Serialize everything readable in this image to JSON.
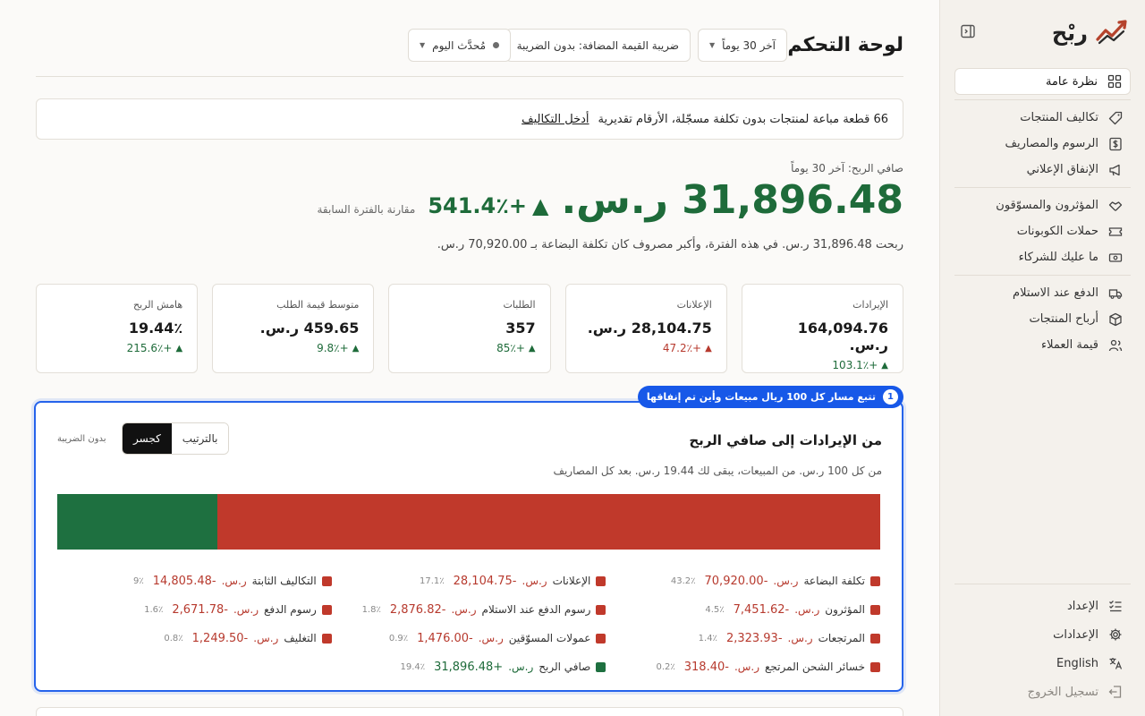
{
  "brand": {
    "name": "ربْح"
  },
  "sidebar": {
    "groups": [
      [
        {
          "label": "نظرة عامة",
          "icon": "grid-icon",
          "active": true
        }
      ],
      [
        {
          "label": "تكاليف المنتجات",
          "icon": "tag-icon"
        },
        {
          "label": "الرسوم والمصاريف",
          "icon": "dollar-icon"
        },
        {
          "label": "الإنفاق الإعلاني",
          "icon": "megaphone-icon"
        }
      ],
      [
        {
          "label": "المؤثرون والمسوّقون",
          "icon": "handshake-icon"
        },
        {
          "label": "حملات الكوبونات",
          "icon": "ticket-icon"
        },
        {
          "label": "ما عليك للشركاء",
          "icon": "cash-icon"
        }
      ],
      [
        {
          "label": "الدفع عند الاستلام",
          "icon": "truck-icon"
        },
        {
          "label": "أرباح المنتجات",
          "icon": "box-icon"
        },
        {
          "label": "قيمة العملاء",
          "icon": "users-icon"
        }
      ]
    ],
    "bottom": [
      {
        "label": "الإعداد",
        "icon": "checklist-icon"
      },
      {
        "label": "الإعدادات",
        "icon": "gear-icon"
      },
      {
        "label": "English",
        "icon": "translate-icon"
      },
      {
        "label": "تسجيل الخروج",
        "icon": "logout-icon",
        "muted": true
      }
    ]
  },
  "header": {
    "title": "لوحة التحكم",
    "period": "آخر 30 يوماً",
    "vat": "ضريبة القيمة المضافة: بدون الضريبة",
    "updated": "مُحدَّث اليوم"
  },
  "notice": {
    "text": "66 قطعة مباعة لمنتجات بدون تكلفة مسجّلة، الأرقام تقديرية",
    "link": "أدخل التكاليف"
  },
  "profit": {
    "label": "صافي الربح: آخر 30 يوماً",
    "value": "31,896.48 ر.س.",
    "change": "+541.4٪",
    "compare": "مقارنة بالفترة السابقة",
    "summary": "ربحت 31,896.48 ر.س. في هذه الفترة، وأكبر مصروف كان تكلفة البضاعة بـ 70,920.00 ر.س."
  },
  "kpis": [
    {
      "label": "الإيرادات",
      "value": "164,094.76 ر.س.",
      "delta": "+103.1٪",
      "tone": "green"
    },
    {
      "label": "الإعلانات",
      "value": "28,104.75 ر.س.",
      "delta": "+47.2٪",
      "tone": "red"
    },
    {
      "label": "الطلبات",
      "value": "357",
      "delta": "+85٪",
      "tone": "green"
    },
    {
      "label": "متوسط قيمة الطلب",
      "value": "459.65 ر.س.",
      "delta": "+9.8٪",
      "tone": "green"
    },
    {
      "label": "هامش الربح",
      "value": "19.44٪",
      "delta": "+215.6٪",
      "tone": "green"
    }
  ],
  "step": {
    "number": "1",
    "text": "تتبع مسار كل 100 ريال مبيعات وأين تم إنفاقها"
  },
  "waterfall": {
    "title": "من الإيرادات إلى صافي الربح",
    "subtitle": "من كل 100 ر.س. من المبيعات، يبقى لك 19.44 ر.س. بعد كل المصاريف",
    "toggle": [
      "بالترتيب",
      "كجسر"
    ],
    "active_toggle": 1,
    "tax_note": "بدون الضريبة",
    "colors": {
      "cost": "#c0392b",
      "profit": "#1e7040"
    },
    "bar": [
      {
        "name": "التكاليف",
        "share": 0.8056,
        "color": "#c0392b"
      },
      {
        "name": "صافي الربح",
        "share": 0.1944,
        "color": "#1e7040"
      }
    ],
    "legend": [
      [
        {
          "name": "تكلفة البضاعة",
          "cur": "ر.س.",
          "value": "-70,920.00",
          "pct": "43.2٪"
        },
        {
          "name": "الإعلانات",
          "cur": "ر.س.",
          "value": "-28,104.75",
          "pct": "17.1٪"
        },
        {
          "name": "التكاليف الثابتة",
          "cur": "ر.س.",
          "value": "-14,805.48",
          "pct": "9٪"
        }
      ],
      [
        {
          "name": "المؤثرون",
          "cur": "ر.س.",
          "value": "-7,451.62",
          "pct": "4.5٪"
        },
        {
          "name": "رسوم الدفع عند الاستلام",
          "cur": "ر.س.",
          "value": "-2,876.82",
          "pct": "1.8٪"
        },
        {
          "name": "رسوم الدفع",
          "cur": "ر.س.",
          "value": "-2,671.78",
          "pct": "1.6٪"
        }
      ],
      [
        {
          "name": "المرتجعات",
          "cur": "ر.س.",
          "value": "-2,323.93",
          "pct": "1.4٪"
        },
        {
          "name": "عمولات المسوّقين",
          "cur": "ر.س.",
          "value": "-1,476.00",
          "pct": "0.9٪"
        },
        {
          "name": "التغليف",
          "cur": "ر.س.",
          "value": "-1,249.50",
          "pct": "0.8٪"
        }
      ],
      [
        {
          "name": "خسائر الشحن المرتجع",
          "cur": "ر.س.",
          "value": "-318.40",
          "pct": "0.2٪"
        },
        {
          "name": "صافي الربح",
          "cur": "ر.س.",
          "value": "+31,896.48",
          "pct": "19.4٪",
          "positive": true
        }
      ]
    ]
  }
}
